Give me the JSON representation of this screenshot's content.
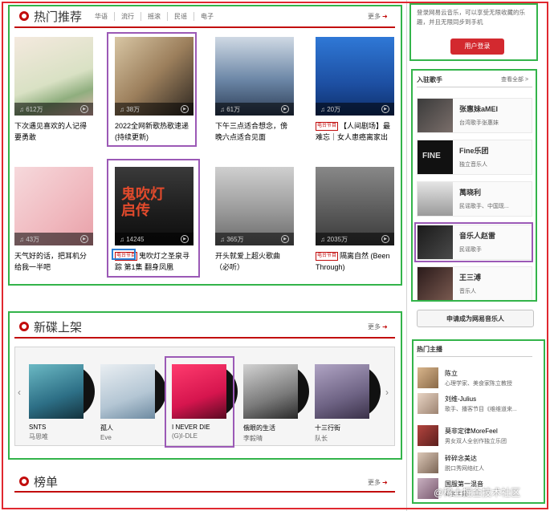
{
  "hot": {
    "title": "热门推荐",
    "tags": [
      "华语",
      "流行",
      "摇滚",
      "民谣",
      "电子"
    ],
    "more": "更多",
    "cards": [
      {
        "count": "612万",
        "caption": "下次遇见喜欢的人记得要勇敢",
        "badge": ""
      },
      {
        "count": "38万",
        "caption": "2022全网新歌热歌速递(持续更新)",
        "badge": ""
      },
      {
        "count": "61万",
        "caption": "下午三点适合想念，傍晚六点适合见面",
        "badge": ""
      },
      {
        "count": "20万",
        "caption": "【人间剧场】最难忘｜女人患癌离家出走，生死未卜",
        "badge": "电台节目"
      },
      {
        "count": "43万",
        "caption": "天气好的话，把耳机分给我一半吧",
        "badge": ""
      },
      {
        "count": "14245",
        "caption": "鬼吹灯之圣泉寻踪 第1集 翻身凤凰",
        "badge": "电台节目"
      },
      {
        "count": "365万",
        "caption": "开头就爱上超火歌曲（必听）",
        "badge": ""
      },
      {
        "count": "2035万",
        "caption": "隔离自然 (Been Through)",
        "badge": "电台节目"
      }
    ]
  },
  "new_albums": {
    "title": "新碟上架",
    "more": "更多",
    "items": [
      {
        "name": "SNTS",
        "artist": "马思唯"
      },
      {
        "name": "孤人",
        "artist": "Eve"
      },
      {
        "name": "I NEVER DIE",
        "artist": "(G)I-DLE"
      },
      {
        "name": "俄眼的生活",
        "artist": "李毅晴"
      },
      {
        "name": "十三行街",
        "artist": "队长"
      }
    ]
  },
  "charts": {
    "title": "榜单",
    "more": "更多"
  },
  "login": {
    "text": "登录网易云音乐，可以享受无限收藏的乐趣，并且无限同步到手机",
    "button": "用户登录"
  },
  "singers": {
    "title": "入驻歌手",
    "more": "查看全部 >",
    "items": [
      {
        "name": "张惠妹aMEI",
        "desc": "台湾歌手张惠妹"
      },
      {
        "name": "Fine乐团",
        "desc": "独立音乐人"
      },
      {
        "name": "萬晓利",
        "desc": "民谣歌手、中国现..."
      },
      {
        "name": "音乐人赵雷",
        "desc": "民谣歌手"
      },
      {
        "name": "王三溥",
        "desc": "音乐人"
      }
    ],
    "apply": "申请成为网易音乐人"
  },
  "djs": {
    "title": "热门主播",
    "items": [
      {
        "name": "陈立",
        "desc": "心理学家、美食家陈立教授"
      },
      {
        "name": "刘维-Julius",
        "desc": "歌手、播客节目《维维道来..."
      },
      {
        "name": "莫非定律MoreFeel",
        "desc": "男女双人全创作独立乐团"
      },
      {
        "name": "碎碎念美达",
        "desc": "脱口秀网络红人"
      },
      {
        "name": "国服第一混音",
        "desc": "知名主播"
      }
    ]
  },
  "watermark": "@稀土掘金技术社区",
  "colors": {
    "accent": "#c20c0c"
  }
}
